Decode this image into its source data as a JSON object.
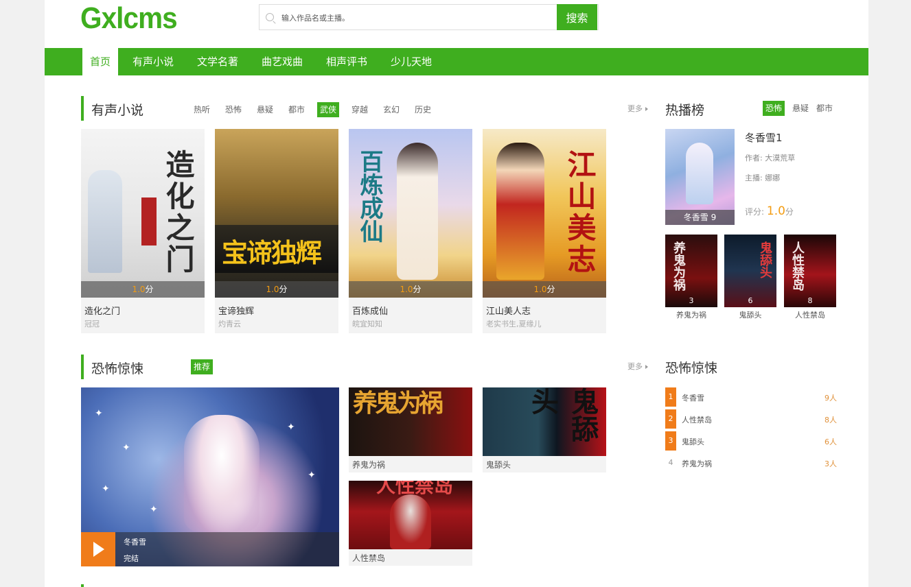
{
  "header": {
    "logo": "Gxlcms",
    "search_placeholder": "输入作品名或主播。",
    "search_button": "搜索"
  },
  "nav": [
    "首页",
    "有声小说",
    "文学名著",
    "曲艺戏曲",
    "相声评书",
    "少儿天地"
  ],
  "section1": {
    "title": "有声小说",
    "tags": [
      "热听",
      "恐怖",
      "悬疑",
      "都市",
      "武侠",
      "穿越",
      "玄幻",
      "历史"
    ],
    "active_tag": "武侠",
    "more": "更多",
    "books": [
      {
        "name": "造化之门",
        "author": "冠冠",
        "score_num": "1.0",
        "score_unit": "分",
        "cover_text": "造化之门"
      },
      {
        "name": "宝谛独辉",
        "author": "灼青云",
        "score_num": "1.0",
        "score_unit": "分",
        "cover_text": "宝谛独辉"
      },
      {
        "name": "百炼成仙",
        "author": "皖宜知知",
        "score_num": "1.0",
        "score_unit": "分",
        "cover_text": "百炼成仙"
      },
      {
        "name": "江山美人志",
        "author": "老实书生,夏缘儿",
        "score_num": "1.0",
        "score_unit": "分",
        "cover_text": "江山美志"
      }
    ]
  },
  "hot": {
    "title": "热播榜",
    "tags": [
      "恐怖",
      "悬疑",
      "都市"
    ],
    "active_tag": "恐怖",
    "top": {
      "name": "冬香雪1",
      "author_label": "作者: 大漠荒草",
      "anchor_label": "主播: 娜娜",
      "score_label": "评分:",
      "score_num": "1.0",
      "score_unit": "分",
      "cover_caption": "冬香雪",
      "cover_rank": "9"
    },
    "minis": [
      {
        "name": "养鬼为祸",
        "rank": "3"
      },
      {
        "name": "鬼舔头",
        "rank": "6"
      },
      {
        "name": "人性禁岛",
        "rank": "8"
      }
    ]
  },
  "section2": {
    "title": "恐怖惊悚",
    "badge": "推荐",
    "more": "更多",
    "big": {
      "name": "冬香雪",
      "status": "完结"
    },
    "small": [
      {
        "name": "养鬼为祸"
      },
      {
        "name": "鬼舔头"
      },
      {
        "name": "人性禁岛"
      }
    ]
  },
  "rank2": {
    "title": "恐怖惊悚",
    "rows": [
      {
        "no": "1",
        "name": "冬香雪",
        "count": "9人"
      },
      {
        "no": "2",
        "name": "人性禁岛",
        "count": "8人"
      },
      {
        "no": "3",
        "name": "鬼舔头",
        "count": "6人"
      },
      {
        "no": "4",
        "name": "养鬼为祸",
        "count": "3人"
      }
    ]
  }
}
